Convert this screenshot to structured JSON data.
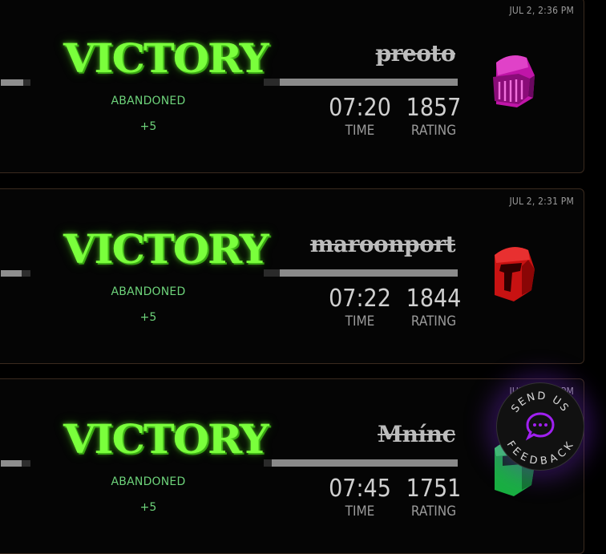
{
  "games": [
    {
      "timestamp": "JUL 2, 2:36 PM",
      "result": "VICTORY",
      "status": "ABANDONED",
      "delta": "+5",
      "opponent": "preoto",
      "time": "07:20",
      "time_label": "TIME",
      "rating": "1857",
      "rating_label": "RATING",
      "avatar_color": "#c015a8",
      "avatar_icon": "knight-helmet-icon"
    },
    {
      "timestamp": "JUL 2, 2:31 PM",
      "result": "VICTORY",
      "status": "ABANDONED",
      "delta": "+5",
      "opponent": "maroonport",
      "time": "07:22",
      "time_label": "TIME",
      "rating": "1844",
      "rating_label": "RATING",
      "avatar_color": "#c81212",
      "avatar_icon": "knight-helmet-icon"
    },
    {
      "timestamp": "JUL 2, 2:27 PM",
      "result": "VICTORY",
      "status": "ABANDONED",
      "delta": "+5",
      "opponent": "Mnínc",
      "time": "07:45",
      "time_label": "TIME",
      "rating": "1751",
      "rating_label": "RATING",
      "avatar_color": "#18b040",
      "avatar_icon": "knight-helmet-icon"
    }
  ],
  "feedback": {
    "line1": "SEND US",
    "line2": "FEEDBACK",
    "icon": "chat-bubble-icon",
    "accent": "#a020f0"
  }
}
